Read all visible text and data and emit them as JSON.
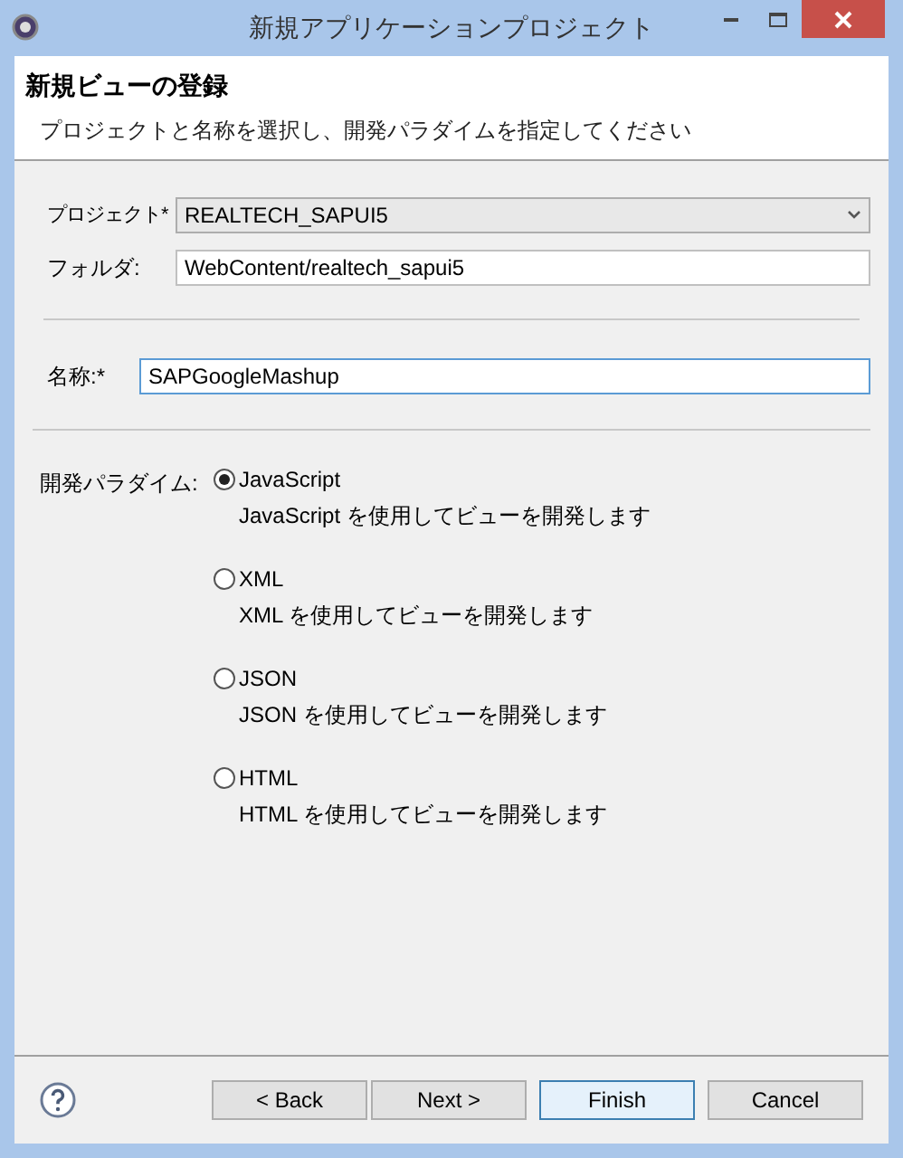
{
  "window": {
    "title": "新規アプリケーションプロジェクト"
  },
  "header": {
    "title": "新規ビューの登録",
    "description": "プロジェクトと名称を選択し、開発パラダイムを指定してください"
  },
  "project": {
    "label": "プロジェクト*",
    "value": "REALTECH_SAPUI5"
  },
  "folder": {
    "label": "フォルダ:",
    "value": "WebContent/realtech_sapui5"
  },
  "name": {
    "label": "名称:*",
    "value": "SAPGoogleMashup"
  },
  "paradigm": {
    "label": "開発パラダイム:",
    "options": [
      {
        "label": "JavaScript",
        "description": "JavaScript を使用してビューを開発します",
        "selected": true
      },
      {
        "label": "XML",
        "description": "XML を使用してビューを開発します",
        "selected": false
      },
      {
        "label": "JSON",
        "description": "JSON を使用してビューを開発します",
        "selected": false
      },
      {
        "label": "HTML",
        "description": "HTML を使用してビューを開発します",
        "selected": false
      }
    ]
  },
  "buttons": [
    {
      "label": "< Back",
      "default": false
    },
    {
      "label": "Next >",
      "default": false
    },
    {
      "label": "Finish",
      "default": true
    },
    {
      "label": "Cancel",
      "default": false
    }
  ]
}
